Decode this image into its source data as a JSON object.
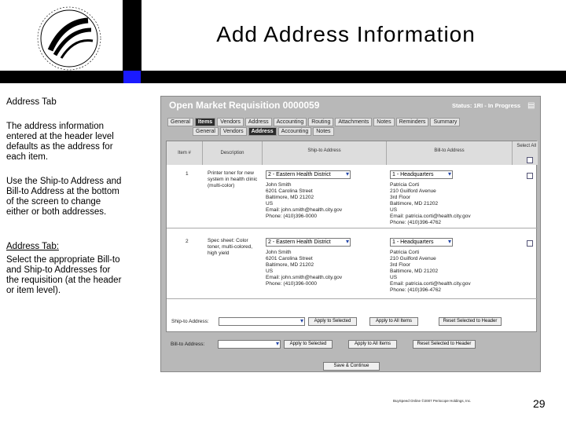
{
  "slide": {
    "title": "Add Address Information",
    "page_number": "29",
    "footer": "BuySpeed Online ©2007 Periscope Holdings, Inc.",
    "logo_text": "SHELBY COUNTY AIRPORT AUTHORITY MEMPHIS"
  },
  "sidebar": {
    "heading": "Address Tab",
    "para1": "The address information entered at the header level defaults as the address for each item.",
    "para2": "Use the Ship-to Address and Bill-to Address at the bottom of the screen to change either or both addresses.",
    "para3_label": "Address Tab:",
    "para3": "Select the appropriate Bill-to and Ship-to Addresses for the requisition (at the header or item level)."
  },
  "app": {
    "title": "Open Market Requisition 0000059",
    "status": "Status: 1RI - In Progress",
    "tabs": [
      "General",
      "Items",
      "Vendors",
      "Address",
      "Accounting",
      "Routing",
      "Attachments",
      "Notes",
      "Reminders",
      "Summary"
    ],
    "subtabs": [
      "General",
      "Vendors",
      "Address",
      "Accounting",
      "Notes"
    ],
    "columns": [
      "Item #",
      "Description",
      "Ship-to Address",
      "Bill-to Address",
      "Select All"
    ],
    "rows": [
      {
        "item": "1",
        "description": "Printer toner for new system in health clinic (multi-color)",
        "ship_select": "2 - Eastern Health District",
        "ship_addr": [
          "John Smith",
          "6201 Carolina Street",
          "Baltimore, MD 21202",
          "US",
          "Email: john.smith@health.city.gov",
          "Phone: (410)396-0000"
        ],
        "bill_select": "1 - Headquarters",
        "bill_addr": [
          "Patricia Corti",
          "210 Guilford Avenue",
          "3rd Floor",
          "Baltimore, MD 21202",
          "US",
          "Email: patricia.corti@health.city.gov",
          "Phone: (410)396-4762"
        ]
      },
      {
        "item": "2",
        "description": "Spec sheet: Color toner, multi-colored, high yield",
        "ship_select": "2 - Eastern Health District",
        "ship_addr": [
          "John Smith",
          "6201 Carolina Street",
          "Baltimore, MD 21202",
          "US",
          "Email: john.smith@health.city.gov",
          "Phone: (410)396-0000"
        ],
        "bill_select": "1 - Headquarters",
        "bill_addr": [
          "Patricia Corti",
          "210 Guilford Avenue",
          "3rd Floor",
          "Baltimore, MD 21202",
          "US",
          "Email: patricia.corti@health.city.gov",
          "Phone: (410)396-4762"
        ]
      }
    ],
    "ship_to_label": "Ship-to Address:",
    "bill_to_label": "Bill-to Address:",
    "ship_buttons": [
      "Apply to Selected",
      "Apply to All Items",
      "Reset Selected to Header"
    ],
    "bill_buttons": [
      "Apply to Selected",
      "Apply to All Items",
      "Reset Selected to Header"
    ],
    "save_button": "Save & Continue"
  }
}
